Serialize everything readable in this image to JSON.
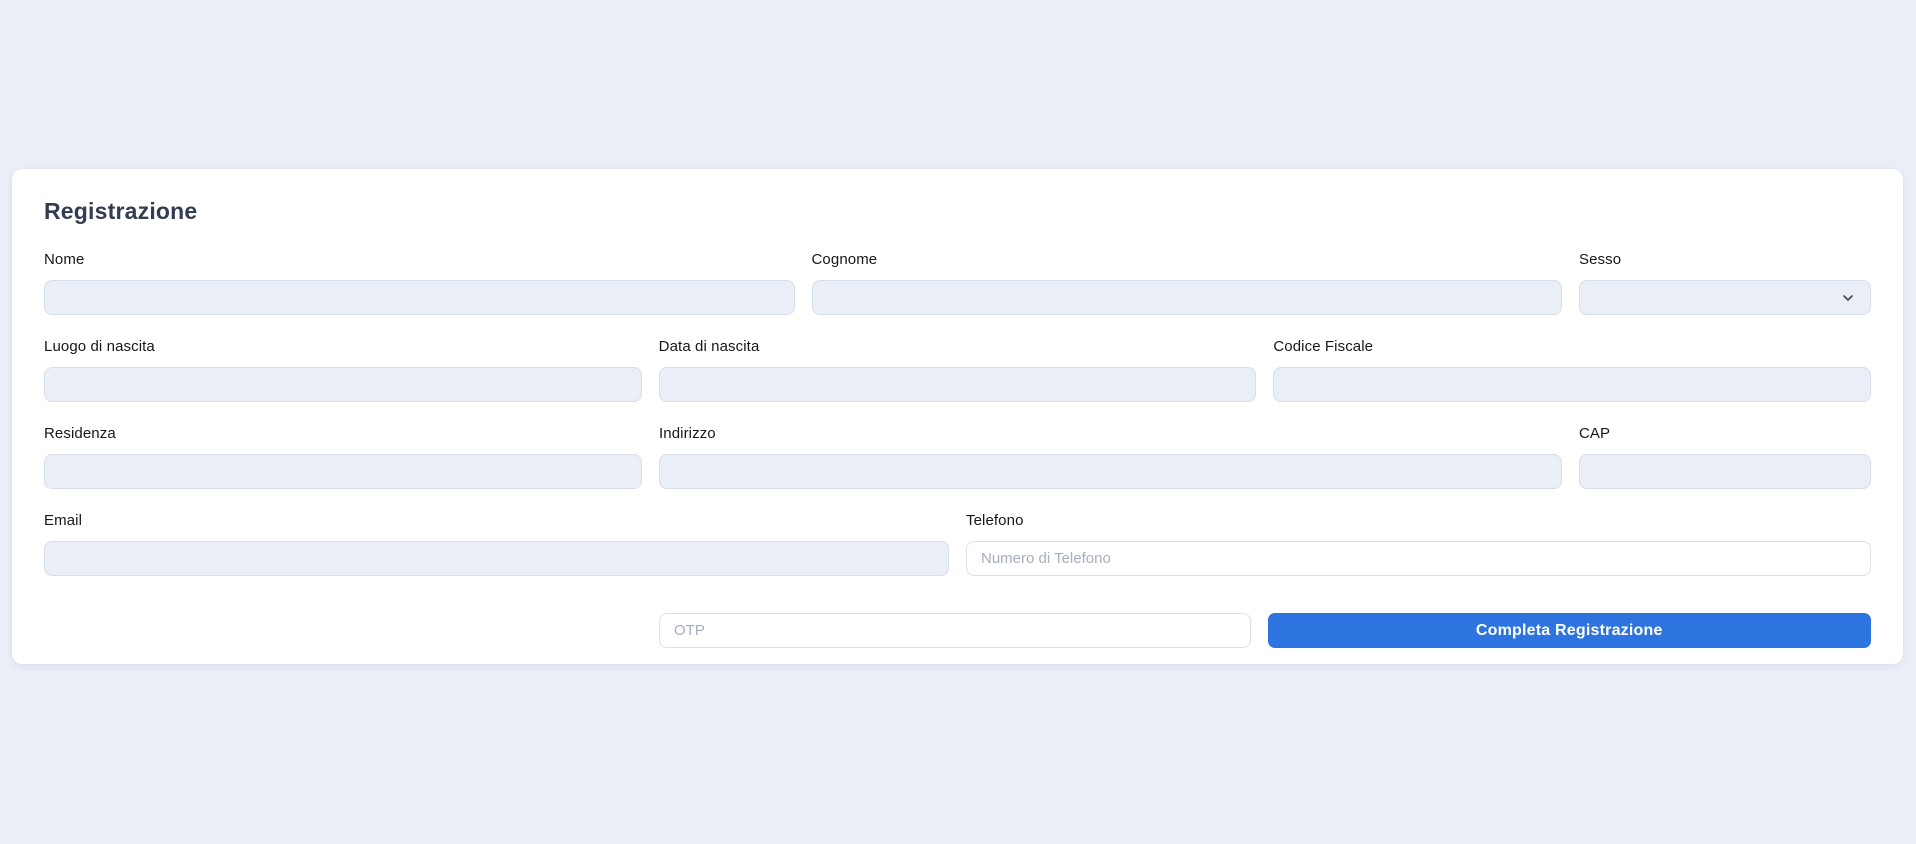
{
  "form": {
    "title": "Registrazione",
    "nome": {
      "label": "Nome",
      "value": ""
    },
    "cognome": {
      "label": "Cognome",
      "value": ""
    },
    "sesso": {
      "label": "Sesso",
      "selected_value": ""
    },
    "luogo_di_nascita": {
      "label": "Luogo di nascita",
      "value": ""
    },
    "data_di_nascita": {
      "label": "Data di nascita",
      "value": ""
    },
    "codice_fiscale": {
      "label": "Codice Fiscale",
      "value": ""
    },
    "residenza": {
      "label": "Residenza",
      "value": ""
    },
    "indirizzo": {
      "label": "Indirizzo",
      "value": ""
    },
    "cap": {
      "label": "CAP",
      "value": ""
    },
    "email": {
      "label": "Email",
      "value": ""
    },
    "telefono": {
      "label": "Telefono",
      "placeholder": "Numero di Telefono",
      "value": ""
    },
    "otp": {
      "placeholder": "OTP",
      "value": ""
    },
    "submit": {
      "label": "Completa Registrazione"
    }
  },
  "icons": {
    "sesso_dropdown": "chevron-down-icon"
  },
  "colors": {
    "accent": "#2e74e0",
    "button_text": "#ffffff",
    "page_background": "#eaeef7",
    "card_background": "#ffffff",
    "input_fill": "#e9eef7",
    "input_border": "#d7deeb",
    "placeholder_text": "#a5adbf",
    "title_text": "#323d52",
    "label_text": "#14171c"
  }
}
